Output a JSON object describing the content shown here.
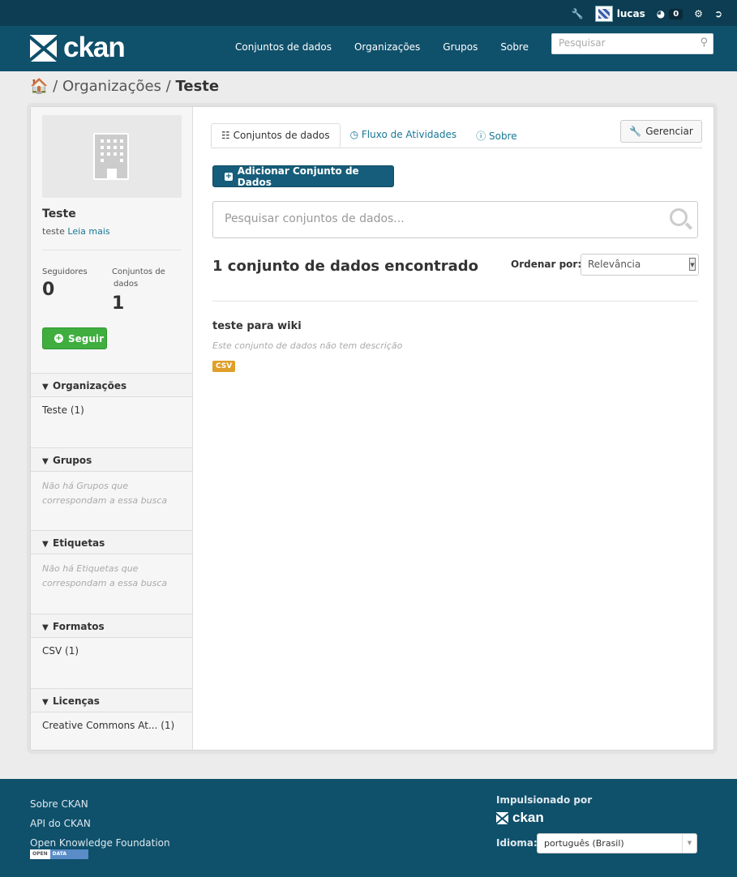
{
  "topbar": {
    "user": "lucas",
    "dashboard_count": "0"
  },
  "masthead": {
    "logo": "ckan",
    "nav": [
      "Conjuntos de dados",
      "Organizações",
      "Grupos",
      "Sobre"
    ],
    "search_placeholder": "Pesquisar"
  },
  "breadcrumb": {
    "sep": "/",
    "section": "Organizações",
    "current": "Teste"
  },
  "org": {
    "name": "Teste",
    "desc": "teste",
    "read_more": "Leia mais",
    "followers_label": "Seguidores",
    "followers": "0",
    "datasets_label_1": "Conjuntos de",
    "datasets_label_2": "dados",
    "datasets": "1",
    "follow_button": "Seguir"
  },
  "facets": {
    "orgs": {
      "title": "Organizações",
      "item": "Teste (1)"
    },
    "groups": {
      "title": "Grupos",
      "empty_1": "Não há Grupos que",
      "empty_2": "correspondam a essa busca"
    },
    "tags": {
      "title": "Etiquetas",
      "empty_1": "Não há Etiquetas que",
      "empty_2": "correspondam a essa busca"
    },
    "formats": {
      "title": "Formatos",
      "item": "CSV (1)"
    },
    "licenses": {
      "title": "Licenças",
      "item": "Creative Commons At... (1)"
    }
  },
  "tabs": {
    "datasets": "Conjuntos de dados",
    "activity": "Fluxo de Atividades",
    "about": "Sobre"
  },
  "manage_button": "Gerenciar",
  "add_button": "Adicionar Conjunto de Dados",
  "dataset_search_placeholder": "Pesquisar conjuntos de dados...",
  "results": {
    "count_text": "1 conjunto de dados encontrado",
    "order_label": "Ordenar por:",
    "order_value": "Relevância"
  },
  "dataset": {
    "title": "teste para wiki",
    "description": "Este conjunto de dados não tem descrição",
    "format": "CSV"
  },
  "footer": {
    "links": [
      "Sobre CKAN",
      "API do CKAN",
      "Open Knowledge Foundation"
    ],
    "badge_left": "OPEN",
    "badge_right": "DATA",
    "powered_by": "Impulsionado por",
    "logo": "ckan",
    "language_label": "Idioma:",
    "language_value": "português (Brasil)"
  },
  "icons": [
    "wrench-icon",
    "dashboard-icon",
    "gear-icon",
    "sign-out-icon",
    "home-icon",
    "building-icon",
    "sitemap-icon",
    "clock-icon",
    "info-icon",
    "plus-square-icon",
    "plus-circle-icon",
    "filter-icon",
    "search-icon"
  ]
}
